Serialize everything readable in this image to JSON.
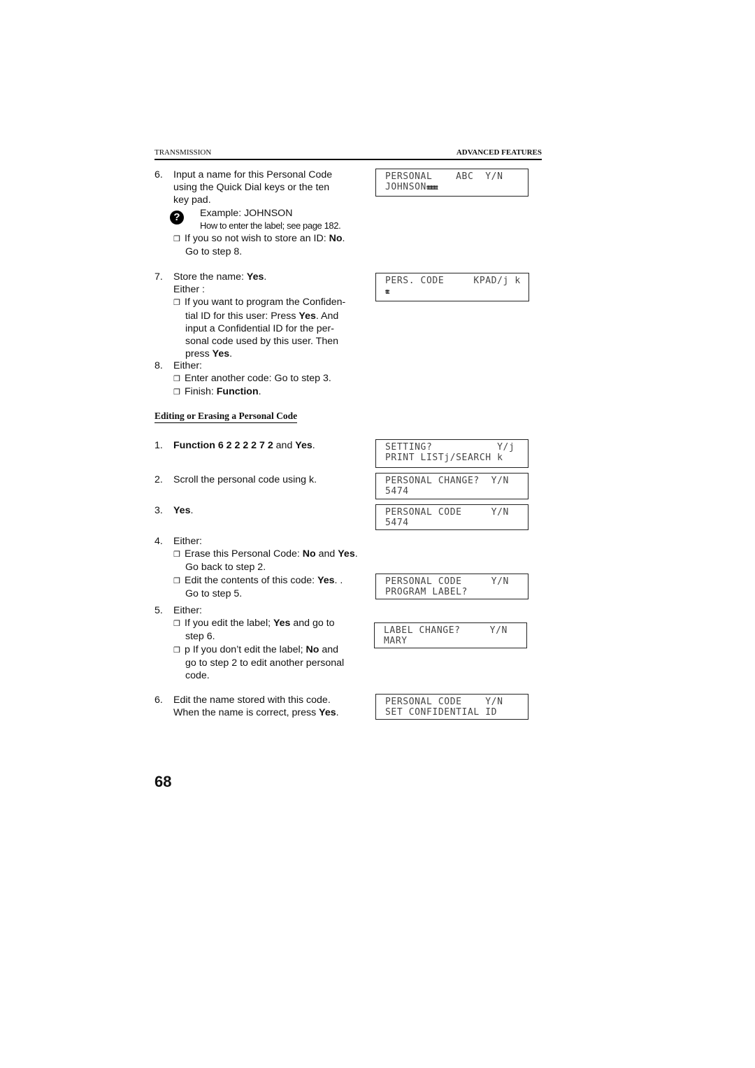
{
  "header": {
    "left": "TRANSMISSION",
    "right": "ADVANCED FEATURES"
  },
  "part1": {
    "step6": {
      "num": "6.",
      "lines": [
        "Input a name for this Personal Code",
        "using the Quick Dial keys or the ten",
        "key pad."
      ],
      "note_icon": "question-icon",
      "example": "Example: JOHNSON",
      "howto": "How to enter the label; see page 182.",
      "bullet_pre": "If you so not wish to store an ID: ",
      "bullet_bold": "No",
      "bullet_post": ".",
      "bullet_line2": "Go to step 8."
    },
    "step7": {
      "num": "7.",
      "line1_pre": "Store the name: ",
      "line1_bold": "Yes",
      "line1_post": ".",
      "either": "Either :",
      "b1": "If you want to program the Confiden-",
      "b2_pre": "tial ID for this user: Press ",
      "b2_bold": "Yes",
      "b2_post": ". And",
      "b3": "input a Confidential ID for the per-",
      "b4": "sonal code used by this user. Then",
      "b5_pre": "press ",
      "b5_bold": "Yes",
      "b5_post": "."
    },
    "step8": {
      "num": "8.",
      "either": "Either:",
      "b1": "Enter another code: Go to step 3.",
      "b2_pre": "Finish: ",
      "b2_bold": "Function",
      "b2_post": "."
    }
  },
  "section_title": "Editing or Erasing a Personal Code",
  "part2": {
    "s1": {
      "num": "1.",
      "bold": "Function 6 2 2 2 2 7 2",
      "mid": " and ",
      "bold2": "Yes",
      "post": "."
    },
    "s2": {
      "num": "2.",
      "text": "Scroll the personal code using k."
    },
    "s3": {
      "num": "3.",
      "bold": "Yes",
      "post": "."
    },
    "s4": {
      "num": "4.",
      "either": "Either:",
      "b1_pre": "Erase this Personal Code: ",
      "b1_bold": "No",
      "b1_mid": " and ",
      "b1_bold2": "Yes",
      "b1_post": ".",
      "b1_line2": "Go back to step 2.",
      "b2_pre": "Edit the contents of this code: ",
      "b2_bold": "Yes",
      "b2_post": ".  .",
      "b2_line2": "Go to step 5."
    },
    "s5": {
      "num": "5.",
      "either": "Either:",
      "b1_pre": "If you edit the label; ",
      "b1_bold": "Yes",
      "b1_post": " and go to",
      "b1_line2": "step 6.",
      "b2_pre": "p If you don’t edit the label; ",
      "b2_bold": "No",
      "b2_post": " and",
      "b2_line2": "go to step 2 to edit another personal",
      "b2_line3": "code."
    },
    "s6": {
      "num": "6.",
      "line1": "Edit the name stored with this code.",
      "line2_pre": "When the name is correct, press ",
      "line2_bold": "Yes",
      "line2_post": "."
    }
  },
  "lcd": [
    {
      "row1": "PERSONAL    ABC  Y/N",
      "row2": "JOHNSON",
      "row2_tail": "tttttttttttt"
    },
    {
      "row1": "PERS. CODE     KPAD/j k",
      "row2": "",
      "row2_tail": "tttt"
    },
    {
      "row1": "SETTING?           Y/j",
      "row2": "PRINT LISTj/SEARCH k"
    },
    {
      "row1": "PERSONAL CHANGE?  Y/N",
      "row2": "5474"
    },
    {
      "row1": "PERSONAL CODE     Y/N",
      "row2": "5474"
    },
    {
      "row1": "PERSONAL CODE     Y/N",
      "row2": "PROGRAM LABEL?"
    },
    {
      "row1": "LABEL CHANGE?     Y/N",
      "row2": "MARY"
    },
    {
      "row1": "PERSONAL CODE    Y/N",
      "row2": "SET CONFIDENTIAL ID"
    }
  ],
  "page_number": "68",
  "checkbox_glyph": "❒"
}
